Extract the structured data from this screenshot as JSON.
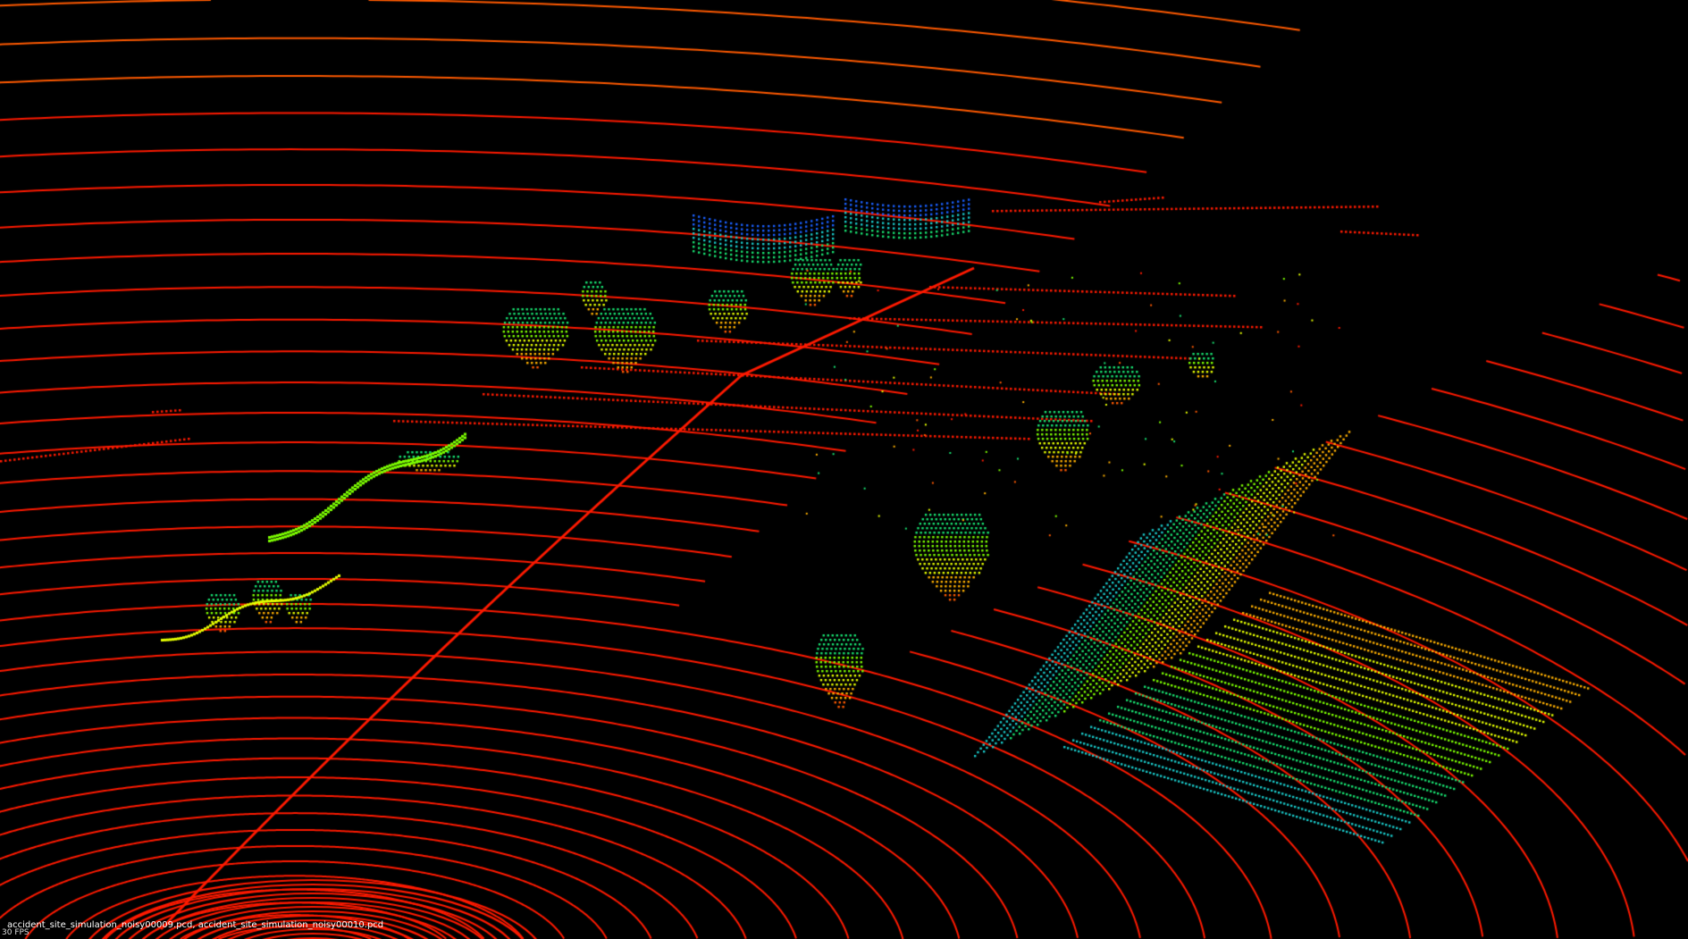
{
  "viewer": {
    "background_color": "#000000",
    "status": {
      "files_label": "accident_site_simulation_noisy00009.pcd, accident_site_simulation_noisy00010.pcd",
      "fps_label": "30 FPS"
    },
    "colormap": [
      "#ff1a00",
      "#ff5a00",
      "#ffb000",
      "#e6ff00",
      "#7dff00",
      "#18e070",
      "#19c8c8",
      "#1a60ff",
      "#2b2bff"
    ]
  }
}
